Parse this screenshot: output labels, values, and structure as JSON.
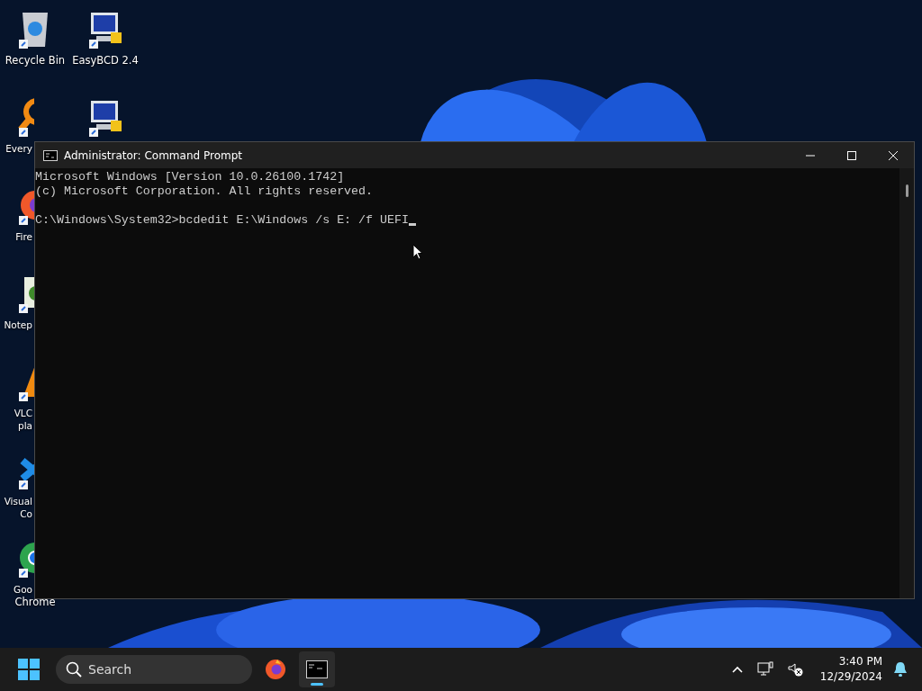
{
  "desktop": {
    "icons": [
      {
        "kind": "recycle",
        "lines": [
          "Recycle Bin"
        ]
      },
      {
        "kind": "search",
        "lines": [
          "Every"
        ]
      },
      {
        "kind": "firefox",
        "lines": [
          "Fire"
        ]
      },
      {
        "kind": "notepad",
        "lines": [
          "Notep"
        ]
      },
      {
        "kind": "vlc",
        "lines": [
          "VLC",
          "pla"
        ]
      },
      {
        "kind": "vscode",
        "lines": [
          "Visual",
          "Co"
        ]
      },
      {
        "kind": "chrome",
        "lines": [
          "Goo",
          "Chrome"
        ]
      },
      {
        "kind": "monitor",
        "lines": [
          "EasyBCD 2.4"
        ]
      },
      {
        "kind": "easyuefi"
      }
    ]
  },
  "window": {
    "title": "Administrator: Command Prompt",
    "blocks": [
      [
        "Microsoft Windows [Version 10.0.26100.1742]",
        "(c) Microsoft Corporation. All rights reserved."
      ],
      [
        "C:\\Windows\\System32>bcdedit E:\\Windows /s E: /f UEFI"
      ]
    ]
  },
  "taskbar": {
    "search": {
      "placeholder": "Search"
    },
    "apps": [
      {
        "kind": "firefox",
        "active": false
      },
      {
        "kind": "terminal",
        "active": true
      }
    ],
    "clock": {
      "time": "3:40 PM",
      "date": "12/29/2024"
    }
  }
}
